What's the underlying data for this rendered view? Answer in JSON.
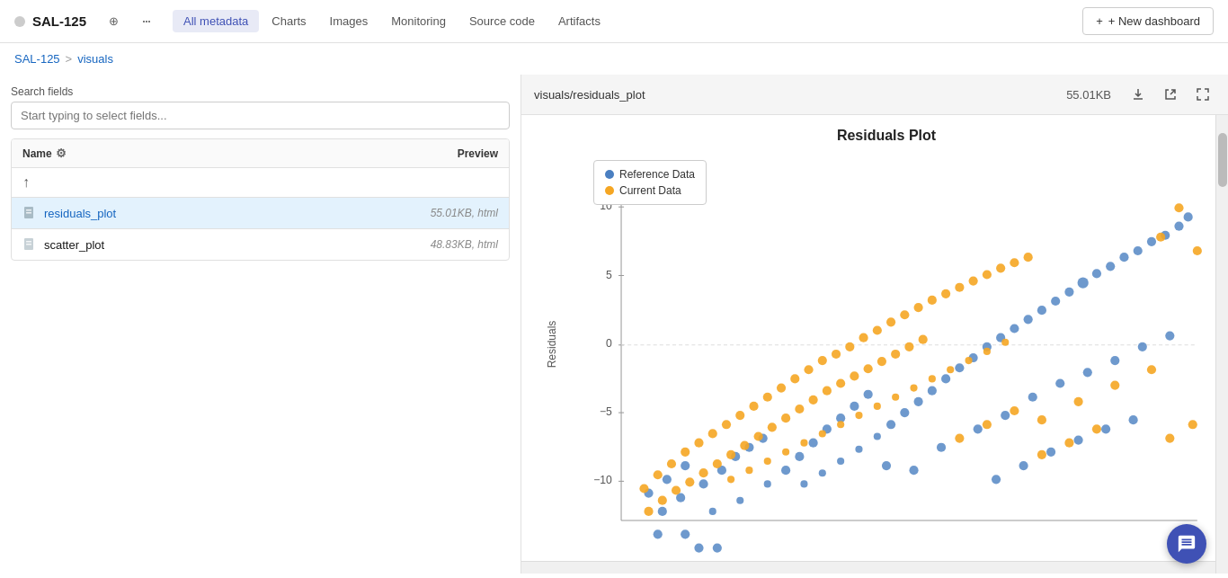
{
  "app": {
    "dot_color": "#ccc",
    "title": "SAL-125",
    "nav": {
      "tabs": [
        {
          "id": "all-metadata",
          "label": "All metadata",
          "active": true
        },
        {
          "id": "charts",
          "label": "Charts",
          "active": false
        },
        {
          "id": "images",
          "label": "Images",
          "active": false
        },
        {
          "id": "monitoring",
          "label": "Monitoring",
          "active": false
        },
        {
          "id": "source-code",
          "label": "Source code",
          "active": false
        },
        {
          "id": "artifacts",
          "label": "Artifacts",
          "active": false
        }
      ],
      "new_dashboard": "+ New dashboard"
    }
  },
  "breadcrumb": {
    "root": "SAL-125",
    "separator": ">",
    "current": "visuals"
  },
  "left": {
    "search_label": "Search fields",
    "search_placeholder": "Start typing to select fields...",
    "table": {
      "col_name": "Name",
      "col_preview": "Preview",
      "rows": [
        {
          "id": "up",
          "type": "up",
          "name": "↑",
          "meta": ""
        },
        {
          "id": "residuals_plot",
          "type": "file",
          "name": "residuals_plot",
          "meta": "55.01KB, html",
          "selected": true
        },
        {
          "id": "scatter_plot",
          "type": "file",
          "name": "scatter_plot",
          "meta": "48.83KB, html",
          "selected": false
        }
      ]
    }
  },
  "right": {
    "header": {
      "path": "visuals/residuals_plot",
      "size": "55.01KB"
    },
    "chart": {
      "title": "Residuals Plot",
      "y_label": "Residuals",
      "legend": [
        {
          "label": "Reference Data",
          "color": "#4a7fc1"
        },
        {
          "label": "Current Data",
          "color": "#f5a623"
        }
      ]
    }
  },
  "icons": {
    "crosshair": "⊕",
    "more": "•••",
    "gear": "⚙",
    "up_arrow": "↑",
    "download": "⬇",
    "external": "⧉",
    "expand": "⤢",
    "chat": "💬",
    "plus": "+"
  }
}
